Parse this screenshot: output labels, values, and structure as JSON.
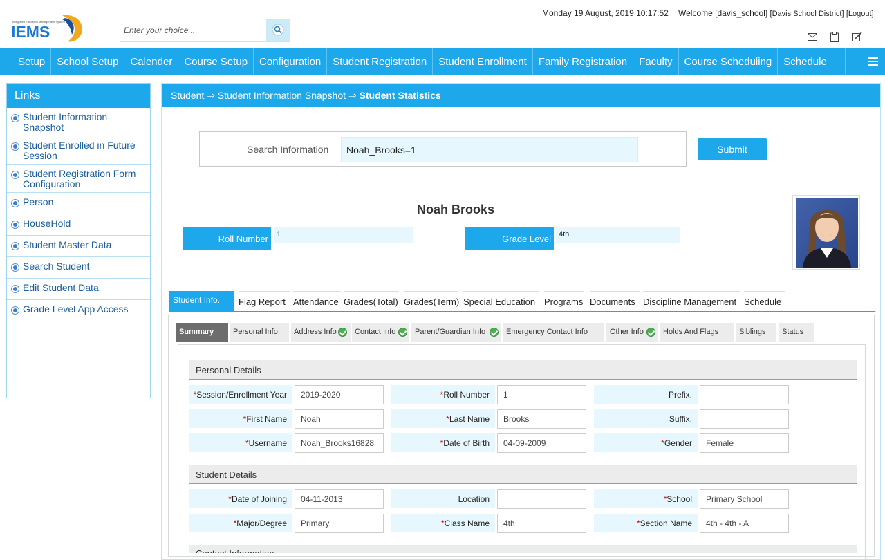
{
  "header": {
    "logo_text": "IEMS",
    "logo_tagline": "Integrated Education Management System",
    "search_placeholder": "Enter your choice...",
    "datetime": "Monday 19 August, 2019 10:17:52",
    "welcome_prefix": "Welcome",
    "username": "[davis_school]",
    "district": "[Davis School District]",
    "logout": "[Logout]",
    "icons": [
      "mail-icon",
      "clipboard-icon",
      "edit-icon"
    ]
  },
  "nav": {
    "items": [
      "Setup",
      "School Setup",
      "Calender",
      "Course Setup",
      "Configuration",
      "Student Registration",
      "Student Enrollment",
      "Family Registration",
      "Faculty",
      "Course Scheduling",
      "Schedule"
    ]
  },
  "sidebar": {
    "title": "Links",
    "items": [
      "Student Information Snapshot",
      "Student Enrolled in Future Session",
      "Student Registration Form Configuration",
      "Person",
      "HouseHold",
      "Student Master Data",
      "Search Student",
      "Edit Student Data",
      "Grade Level App Access"
    ]
  },
  "breadcrumb": {
    "items": [
      "Student",
      "Student Information Snapshot",
      "Student Statistics"
    ],
    "separator": "⇒"
  },
  "search": {
    "label": "Search Information",
    "value": "Noah_Brooks=1",
    "submit": "Submit"
  },
  "student": {
    "name": "Noah Brooks",
    "roll_label": "Roll Number",
    "roll_value": "1",
    "grade_label": "Grade Level",
    "grade_value": "4th"
  },
  "tabs": [
    "Student Info.",
    "Flag Report",
    "Attendance",
    "Grades(Total)",
    "Grades(Term)",
    "Special Education",
    "Programs",
    "Documents",
    "Discipline Management",
    "Schedule"
  ],
  "subtabs": [
    "Summary",
    "Personal Info",
    "Address Info",
    "Contact Info",
    "Parent/Guardian Info",
    "Emergency Contact Info",
    "Other Info",
    "Holds And Flags",
    "Siblings",
    "Status"
  ],
  "personal": {
    "title": "Personal Details",
    "session_label": "Session/Enrollment Year",
    "session_value": "2019-2020",
    "roll_label": "Roll Number",
    "roll_value": "1",
    "prefix_label": "Prefix.",
    "prefix_value": "",
    "first_label": "First Name",
    "first_value": "Noah",
    "last_label": "Last Name",
    "last_value": "Brooks",
    "suffix_label": "Suffix.",
    "suffix_value": "",
    "username_label": "Username",
    "username_value": "Noah_Brooks16828",
    "dob_label": "Date of Birth",
    "dob_value": "04-09-2009",
    "gender_label": "Gender",
    "gender_value": "Female"
  },
  "studentdet": {
    "title": "Student Details",
    "doj_label": "Date of Joining",
    "doj_value": "04-11-2013",
    "location_label": "Location",
    "location_value": "",
    "school_label": "School",
    "school_value": "Primary School",
    "major_label": "Major/Degree",
    "major_value": "Primary",
    "class_label": "Class Name",
    "class_value": "4th",
    "section_label": "Section Name",
    "section_value": "4th - 4th - A"
  },
  "contact": {
    "title": "Contact Information"
  },
  "colors": {
    "accent": "#1ea8ec",
    "field_bg": "#e6f8fe",
    "required": "#dd0000"
  }
}
